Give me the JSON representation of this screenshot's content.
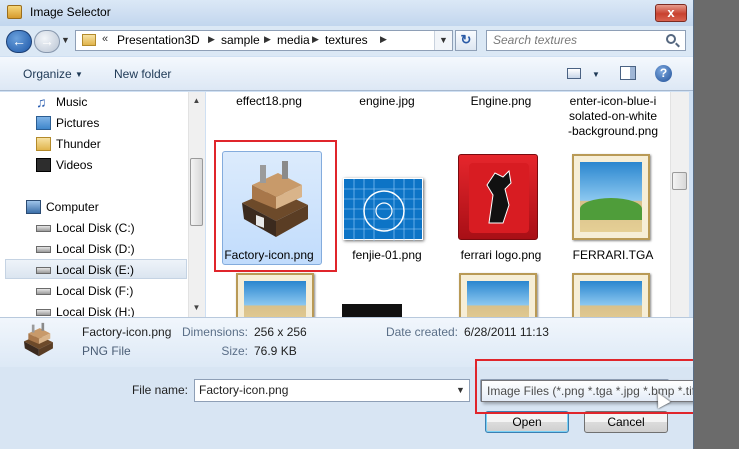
{
  "window": {
    "title": "Image Selector",
    "close_label": "x"
  },
  "address": {
    "chevron": "«",
    "crumbs": [
      "Presentation3D",
      "sample",
      "media",
      "textures"
    ],
    "search_placeholder": "Search textures"
  },
  "toolbar": {
    "organize": "Organize",
    "new_folder": "New folder",
    "help": "?"
  },
  "nav": {
    "items": [
      {
        "label": "Music",
        "icon": "music-icon"
      },
      {
        "label": "Pictures",
        "icon": "pictures-icon"
      },
      {
        "label": "Thunder",
        "icon": "folder-icon"
      },
      {
        "label": "Videos",
        "icon": "videos-icon"
      },
      {
        "label": "Computer",
        "icon": "computer-icon"
      },
      {
        "label": "Local Disk (C:)",
        "icon": "disk-icon"
      },
      {
        "label": "Local Disk (D:)",
        "icon": "disk-icon"
      },
      {
        "label": "Local Disk (E:)",
        "icon": "disk-icon",
        "selected": true
      },
      {
        "label": "Local Disk (F:)",
        "icon": "disk-icon"
      },
      {
        "label": "Local Disk (H:)",
        "icon": "disk-icon"
      }
    ]
  },
  "files": {
    "top_row": [
      "effect18.png",
      "engine.jpg",
      "Engine.png",
      "enter-icon-blue-isolated-on-white-background.png"
    ],
    "top_row_lines": [
      "enter-icon-blue-i",
      "solated-on-white",
      "-background.png"
    ],
    "mid_row": [
      "Factory-icon.png",
      "fenjie-01.png",
      "ferrari logo.png",
      "FERRARI.TGA"
    ],
    "selected": "Factory-icon.png"
  },
  "details": {
    "name": "Factory-icon.png",
    "type": "PNG File",
    "dimensions_label": "Dimensions:",
    "dimensions": "256 x 256",
    "size_label": "Size:",
    "size": "76.9 KB",
    "date_label": "Date created:",
    "date": "6/28/2011 11:13"
  },
  "bottom": {
    "file_name_label": "File name:",
    "file_name_value": "Factory-icon.png",
    "filter_tooltip": "Image Files (*.png *.tga *.jpg *.bmp *.tif *.gif)",
    "open": "Open",
    "cancel": "Cancel"
  },
  "colors": {
    "highlight_box": "#e0252b",
    "selection": "#c1dcfc"
  }
}
